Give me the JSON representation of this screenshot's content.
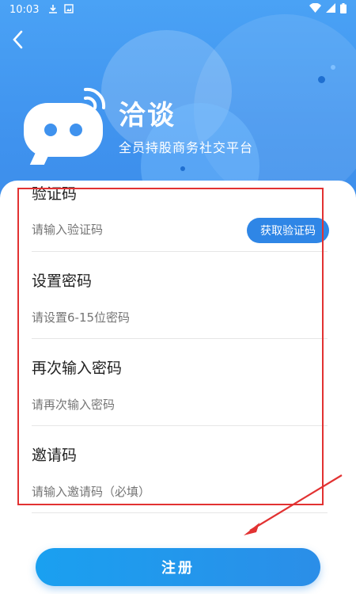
{
  "status_bar": {
    "time": "10:03"
  },
  "brand": {
    "name": "洽谈",
    "slogan": "全员持股商务社交平台"
  },
  "form": {
    "code": {
      "label": "验证码",
      "placeholder": "请输入验证码",
      "button": "获取验证码"
    },
    "password": {
      "label": "设置密码",
      "placeholder": "请设置6-15位密码"
    },
    "confirm": {
      "label": "再次输入密码",
      "placeholder": "请再次输入密码"
    },
    "invite": {
      "label": "邀请码",
      "placeholder": "请输入邀请码（必填）"
    }
  },
  "register_button": "注册",
  "colors": {
    "primary": "#2f86e6",
    "highlight": "#e23232"
  },
  "icons": [
    "back-arrow-icon",
    "download-icon",
    "image-icon",
    "wifi-icon",
    "signal-icon",
    "battery-icon"
  ]
}
